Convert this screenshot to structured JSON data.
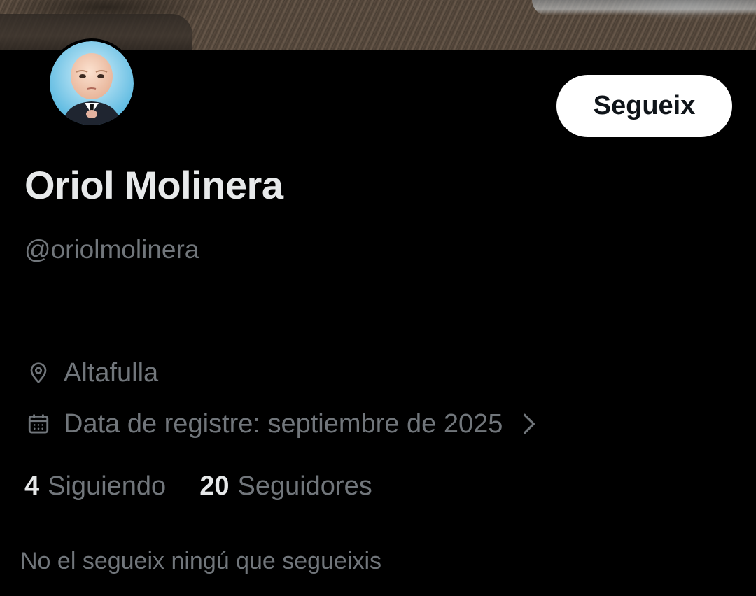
{
  "profile": {
    "display_name": "Oriol Molinera",
    "handle": "@oriolmolinera",
    "follow_label": "Segueix",
    "location": "Altafulla",
    "joined": "Data de registre: septiembre de 2025",
    "following_count": "4",
    "following_label": "Siguiendo",
    "followers_count": "20",
    "followers_label": "Seguidores",
    "followers_you_know": "No el segueix ningú que segueixis"
  },
  "icons": {
    "location": "map-pin-icon",
    "joined": "calendar-icon",
    "chevron": "chevron-right-icon"
  },
  "colors": {
    "background": "#000000",
    "primary_text": "#e7e9ea",
    "secondary_text": "#71767b",
    "button_bg": "#ffffff",
    "button_text": "#0f1419"
  }
}
